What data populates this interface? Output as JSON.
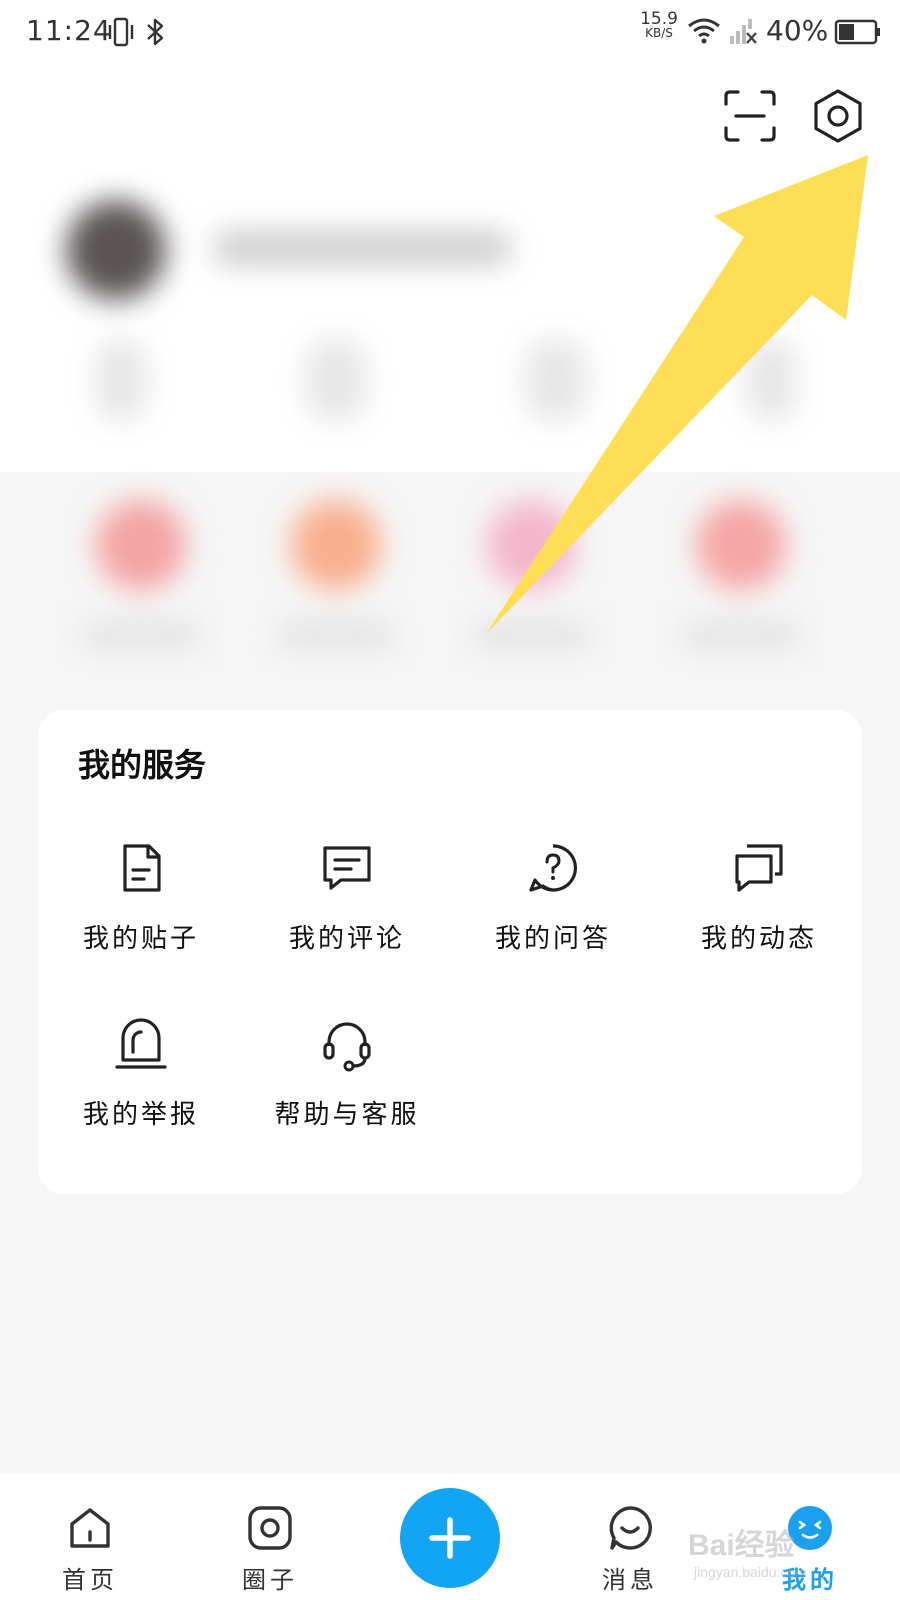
{
  "status_bar": {
    "time": "11:24",
    "net_speed_value": "15.9",
    "net_speed_unit": "KB/S",
    "battery_percent": "40%",
    "icons": [
      "vibrate-icon",
      "bluetooth-icon",
      "wifi-icon",
      "cellular-no-signal-icon",
      "battery-icon"
    ]
  },
  "header": {
    "icons": [
      "scan-icon",
      "settings-icon"
    ]
  },
  "services": {
    "title": "我的服务",
    "items": [
      {
        "label": "我的贴子",
        "icon": "post-document-icon"
      },
      {
        "label": "我的评论",
        "icon": "comment-icon"
      },
      {
        "label": "我的问答",
        "icon": "question-answer-icon"
      },
      {
        "label": "我的动态",
        "icon": "activity-chat-icon"
      },
      {
        "label": "我的举报",
        "icon": "report-alarm-icon"
      },
      {
        "label": "帮助与客服",
        "icon": "customer-service-headset-icon"
      }
    ]
  },
  "bottom_nav": {
    "items": [
      {
        "label": "首页",
        "icon": "home-icon"
      },
      {
        "label": "圈子",
        "icon": "circle-icon"
      },
      {
        "label": "消息",
        "icon": "message-icon"
      },
      {
        "label": "我的",
        "icon": "profile-face-icon",
        "active": true
      }
    ],
    "add_icon": "plus-icon"
  },
  "watermark": {
    "main": "Bai经验",
    "sub": "jingyan.baidu.com"
  },
  "colors": {
    "accent": "#12a5f4",
    "arrow": "#fdde55",
    "background": "#f6f6f6"
  }
}
